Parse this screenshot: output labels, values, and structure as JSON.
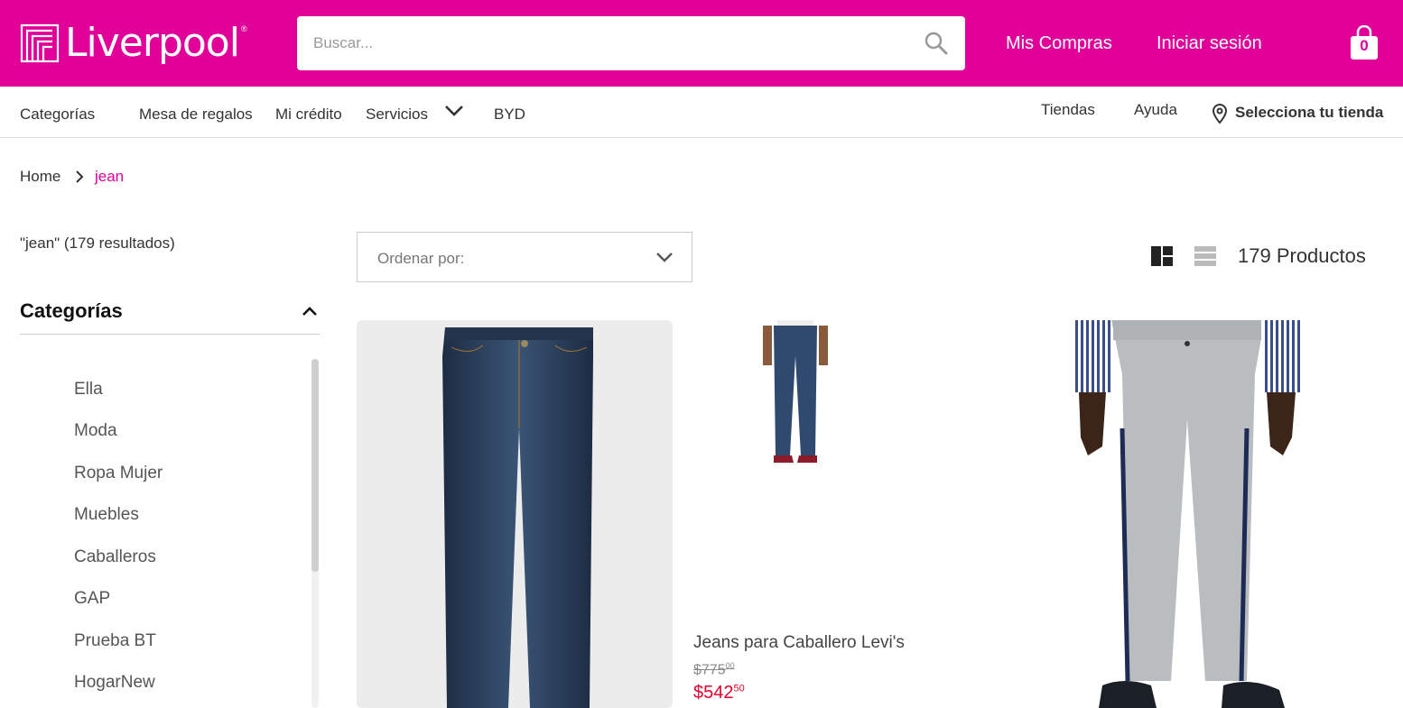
{
  "colors": {
    "brand": "#e10098",
    "price_sale": "#e4002b"
  },
  "header": {
    "logo_text": "Liverpool",
    "search_placeholder": "Buscar...",
    "mis_compras": "Mis Compras",
    "iniciar_sesion": "Iniciar sesión",
    "cart_count": "0"
  },
  "nav": {
    "categorias": "Categorías",
    "mesa_regalos": "Mesa de regalos",
    "mi_credito": "Mi crédito",
    "servicios": "Servicios",
    "byd": "BYD",
    "tiendas": "Tiendas",
    "ayuda": "Ayuda",
    "selecciona_tienda": "Selecciona tu tienda"
  },
  "breadcrumb": {
    "home": "Home",
    "current": "jean"
  },
  "sidebar": {
    "results_text": "\"jean\" (179 resultados)",
    "categories_title": "Categorías",
    "categories": [
      "Ella",
      "Moda",
      "Ropa Mujer",
      "Muebles",
      "Caballeros",
      "GAP",
      "Prueba BT",
      "HogarNew"
    ]
  },
  "toolbar": {
    "sort_label": "Ordenar por:",
    "product_count": "179 Productos"
  },
  "products": [
    {
      "name": "",
      "image": "dark-wash-skinny-jeans"
    },
    {
      "name": "Jeans para Caballero Levi's",
      "old_price_main": "$775",
      "old_price_cents": "00",
      "price_main": "$542",
      "price_cents": "50",
      "image": "man-in-jeans"
    },
    {
      "name": "",
      "image": "grey-pants-with-stripe"
    }
  ]
}
